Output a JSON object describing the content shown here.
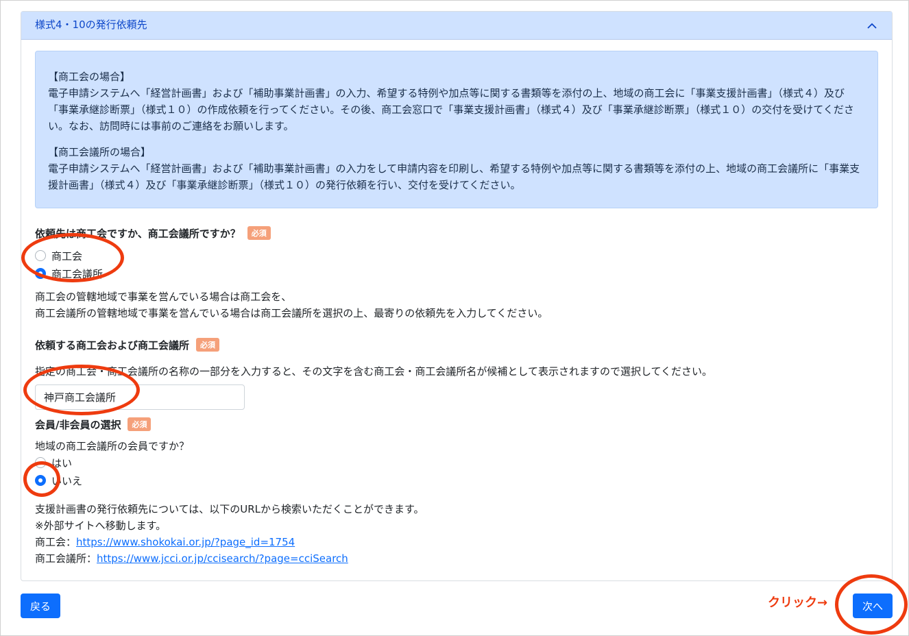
{
  "accordion": {
    "title": "様式4・10の発行依頼先"
  },
  "info": {
    "shokokai_heading": "【商工会の場合】",
    "shokokai_text": "電子申請システムへ「経営計画書」および「補助事業計画書」の入力、希望する特例や加点等に関する書類等を添付の上、地域の商工会に「事業支援計画書」（様式４）及び「事業承継診断票」（様式１０）の作成依頼を行ってください。その後、商工会窓口で「事業支援計画書」（様式４）及び「事業承継診断票」（様式１０）の交付を受けてください。なお、訪問時には事前のご連絡をお願いします。",
    "cci_heading": "【商工会議所の場合】",
    "cci_text": "電子申請システムへ「経営計画書」および「補助事業計画書」の入力をして申請内容を印刷し、希望する特例や加点等に関する書類等を添付の上、地域の商工会議所に「事業支援計画書」（様式４）及び「事業承継診断票」（様式１０）の発行依頼を行い、交付を受けてください。"
  },
  "q1": {
    "label": "依頼先は商工会ですか、商工会議所ですか？",
    "badge": "必須",
    "options": [
      "商工会",
      "商工会議所"
    ],
    "selected": "商工会議所",
    "help_line1": "商工会の管轄地域で事業を営んでいる場合は商工会を、",
    "help_line2": "商工会議所の管轄地域で事業を営んでいる場合は商工会議所を選択の上、最寄りの依頼先を入力してください。"
  },
  "q2": {
    "label": "依頼する商工会および商工会議所",
    "badge": "必須",
    "help": "指定の商工会・商工会議所の名称の一部分を入力すると、その文字を含む商工会・商工会議所名が候補として表示されますので選択してください。",
    "value": "神戸商工会議所"
  },
  "q3": {
    "label": "会員/非会員の選択",
    "badge": "必須",
    "question": "地域の商工会議所の会員ですか？",
    "options": [
      "はい",
      "いいえ"
    ],
    "selected": "いいえ"
  },
  "links": {
    "intro": "支援計画書の発行依頼先については、以下のURLから検索いただくことができます。",
    "note": "※外部サイトへ移動します。",
    "shokokai_prefix": "商工会：",
    "shokokai_url": "https://www.shokokai.or.jp/?page_id=1754",
    "cci_prefix": "商工会議所：",
    "cci_url": "https://www.jcci.or.jp/ccisearch/?page=cciSearch"
  },
  "buttons": {
    "back": "戻る",
    "next": "次へ"
  },
  "annotation": {
    "callout": "クリック→",
    "color": "#ee3b0f"
  }
}
